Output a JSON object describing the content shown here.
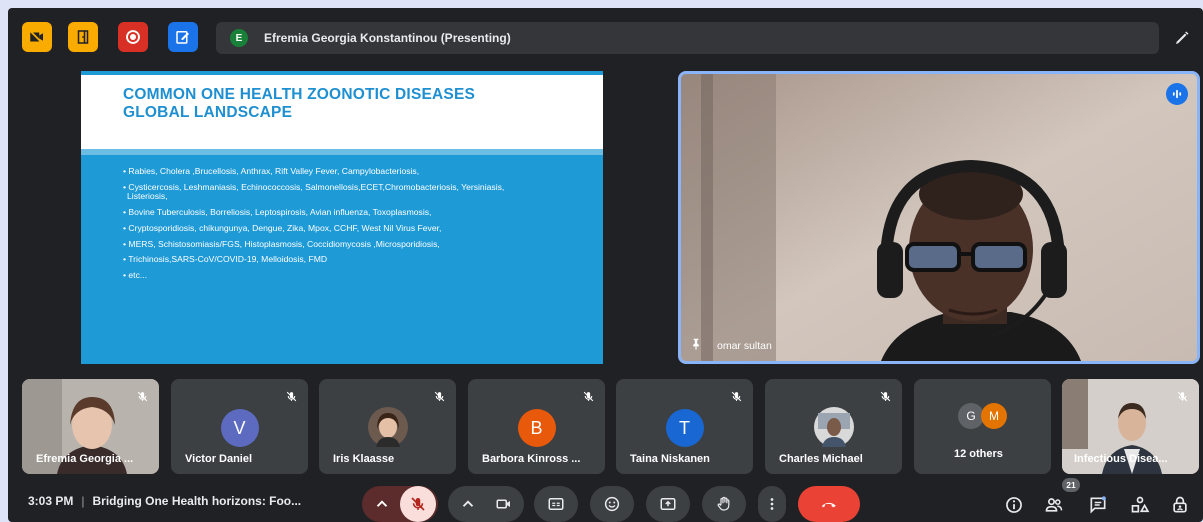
{
  "top_bar": {
    "icons": [
      {
        "name": "camera-off-icon",
        "color": "#f9ab00"
      },
      {
        "name": "door-exit-icon",
        "color": "#f9ab00"
      },
      {
        "name": "record-icon",
        "color": "#d93025"
      },
      {
        "name": "edit-form-icon",
        "color": "#1a73e8"
      }
    ],
    "presenter_initial": "E",
    "presenter_label": "Efremia Georgia Konstantinou (Presenting)",
    "pen_icon": "pen-icon"
  },
  "slide": {
    "title": "COMMON ONE HEALTH ZOONOTIC DISEASES GLOBAL LANDSCAPE",
    "bullets": [
      "Rabies, Cholera ,Brucellosis, Anthrax, Rift Valley Fever, Campylobacteriosis,",
      "Cysticercosis, Leshmaniasis, Echinococcosis, Salmonellosis,ECET,Chromobacteriosis, Yersiniasis, Listeriosis,",
      "Bovine Tuberculosis, Borreliosis, Leptospirosis, Avian influenza, Toxoplasmosis,",
      "Cryptosporidiosis, chikungunya, Dengue, Zika, Mpox, CCHF, West Nil Virus Fever,",
      "MERS, Schistosomiasis/FGS, Histoplasmosis, Coccidiomycosis ,Microsporidiosis,",
      "Trichinosis,SARS-CoV/COVID-19, Melloidosis, FMD",
      "etc..."
    ],
    "colors": {
      "background": "#1e9ad6",
      "title": "#1e8fd0"
    }
  },
  "featured_video": {
    "name": "omar sultan",
    "speaking": true
  },
  "participants": [
    {
      "label": "Efremia Georgia ...",
      "type": "video",
      "muted": true
    },
    {
      "label": "Victor Daniel",
      "type": "avatar",
      "initial": "V",
      "color": "#5c6bc0",
      "muted": true
    },
    {
      "label": "Iris Klaasse",
      "type": "photo",
      "muted": true
    },
    {
      "label": "Barbora Kinross ...",
      "type": "avatar",
      "initial": "B",
      "color": "#e8590c",
      "muted": true
    },
    {
      "label": "Taina Niskanen",
      "type": "avatar",
      "initial": "T",
      "color": "#1967d2",
      "muted": true
    },
    {
      "label": "Charles Michael",
      "type": "photo",
      "muted": true
    },
    {
      "label": "12 others",
      "type": "group",
      "initials": [
        "G",
        "M"
      ],
      "muted": false
    },
    {
      "label": "Infectious Disea...",
      "type": "video",
      "muted": true
    }
  ],
  "bottom_bar": {
    "time": "3:03 PM",
    "meeting_title": "Bridging One Health horizons: Foo...",
    "people_count": "21",
    "controls": [
      "chevron-up-icon",
      "mic-off-icon",
      "chevron-up-icon",
      "camera-icon",
      "captions-icon",
      "emoji-icon",
      "present-icon",
      "raise-hand-icon",
      "more-options-icon",
      "end-call-icon"
    ],
    "right_icons": [
      "info-icon",
      "people-icon",
      "chat-icon",
      "activities-icon",
      "host-controls-icon"
    ]
  }
}
